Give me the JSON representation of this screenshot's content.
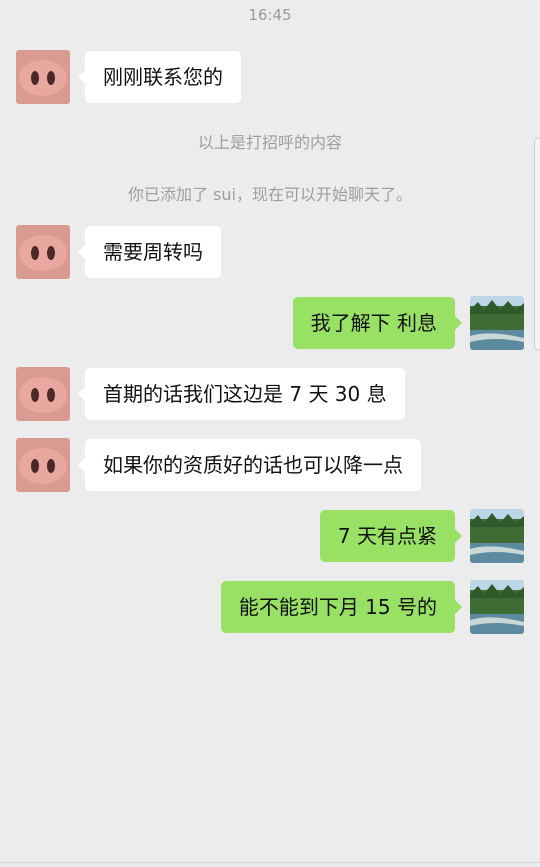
{
  "status": {
    "time": "16:45"
  },
  "system_messages": [
    "以上是打招呼的内容",
    "你已添加了 sui，现在可以开始聊天了。"
  ],
  "messages": [
    {
      "side": "left",
      "text": "刚刚联系您的"
    },
    {
      "side": "left",
      "text": "需要周转吗"
    },
    {
      "side": "right",
      "text": "我了解下 利息"
    },
    {
      "side": "left",
      "text": "首期的话我们这边是 7 天 30 息"
    },
    {
      "side": "left",
      "text": "如果你的资质好的话也可以降一点"
    },
    {
      "side": "right",
      "text": "7 天有点紧"
    },
    {
      "side": "right",
      "text": "能不能到下月 15 号的"
    }
  ],
  "colors": {
    "background": "#ececec",
    "bubble_other": "#ffffff",
    "bubble_self": "#98e165",
    "system_text": "#9e9e9e"
  },
  "icons": {
    "contact_avatar": "pig-nose-avatar",
    "self_avatar": "forest-river-avatar"
  }
}
